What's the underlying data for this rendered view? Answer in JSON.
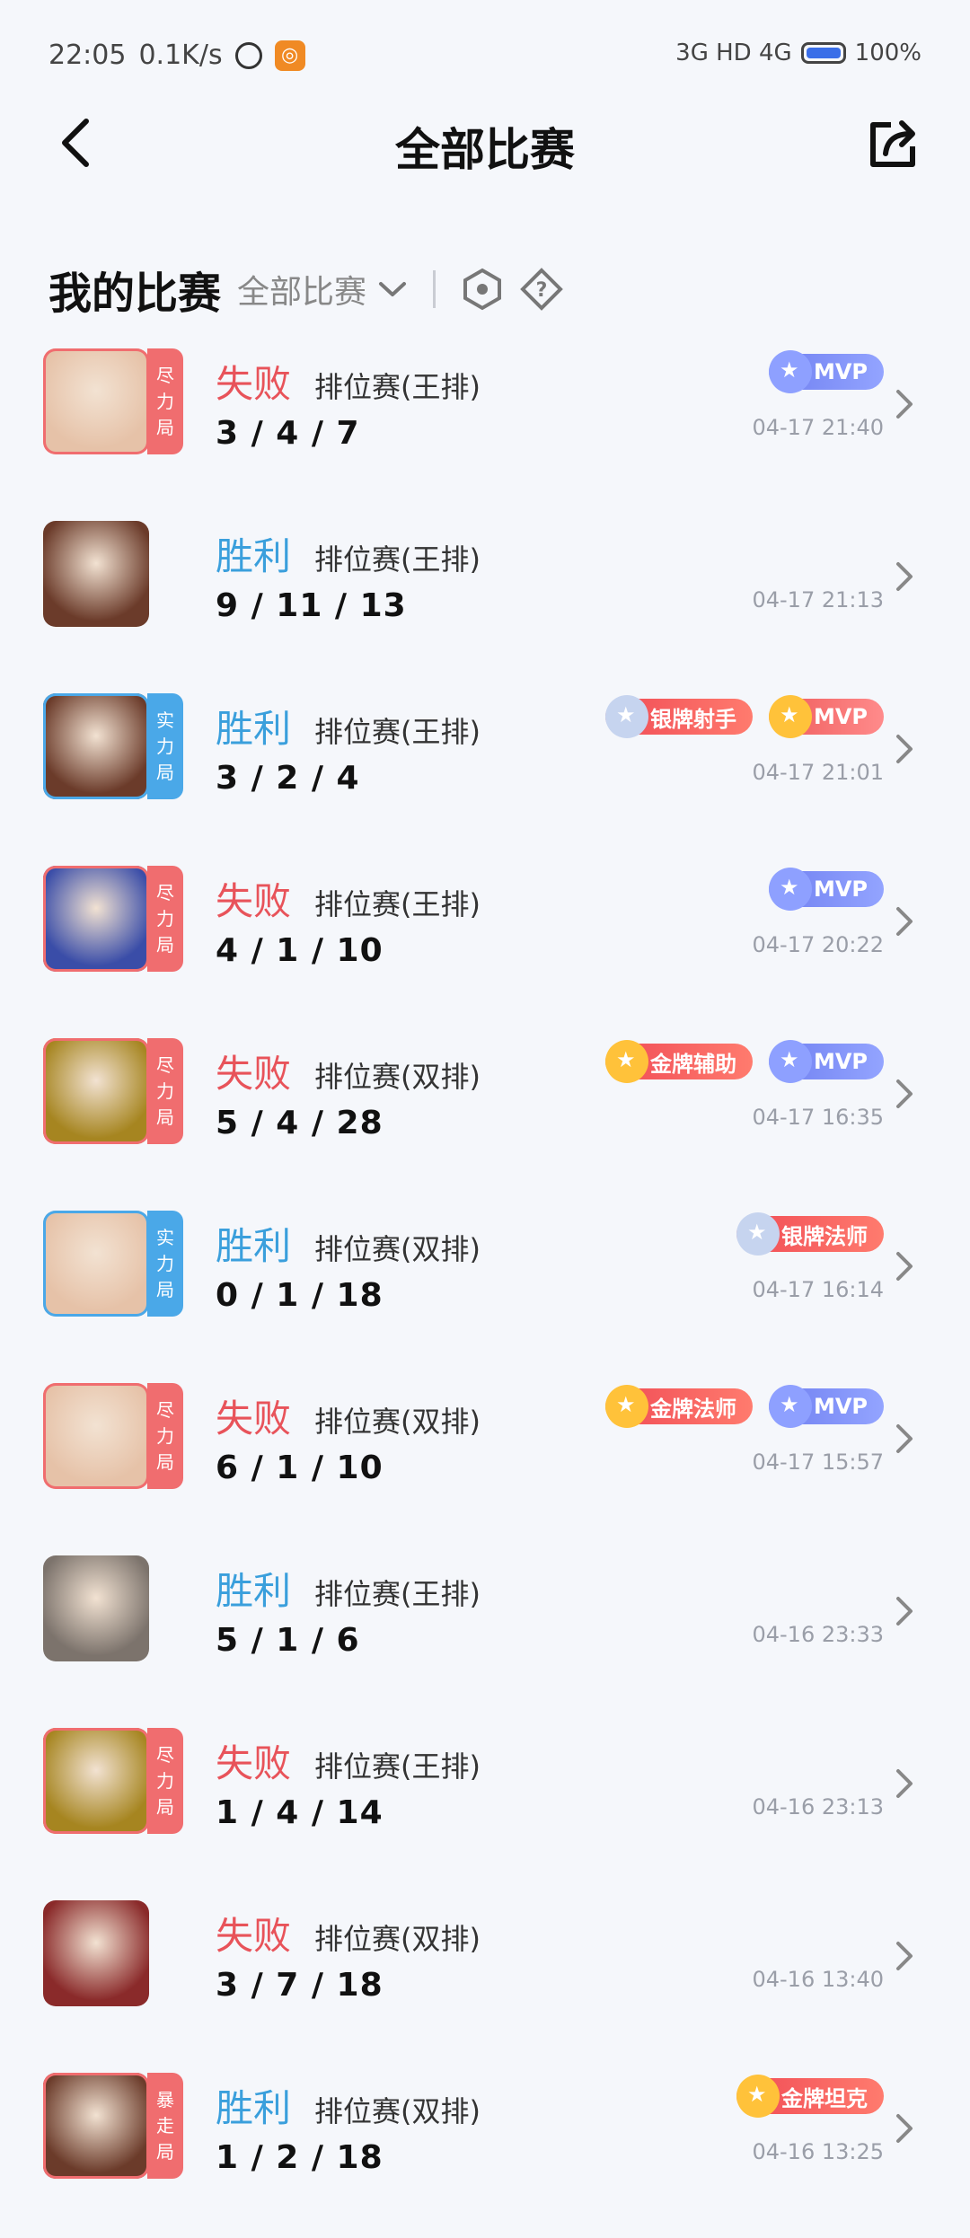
{
  "status_bar": {
    "time": "22:05",
    "speed": "0.1K/s",
    "network": "3G HD 4G",
    "battery": "100%"
  },
  "header": {
    "title": "全部比赛"
  },
  "filter": {
    "title": "我的比赛",
    "selected": "全部比赛"
  },
  "matches": [
    {
      "result": "失败",
      "mode": "排位赛(王排)",
      "kda": "3 / 4 / 7",
      "time": "04-17 21:40",
      "tag": "尽力局",
      "badges": [
        "MVP"
      ],
      "avatar_color": "#e6c2a8"
    },
    {
      "result": "胜利",
      "mode": "排位赛(王排)",
      "kda": "9 / 11 / 13",
      "time": "04-17 21:13",
      "tag": "",
      "badges": [],
      "avatar_color": "#6b3b2a"
    },
    {
      "result": "胜利",
      "mode": "排位赛(王排)",
      "kda": "3 / 2 / 4",
      "time": "04-17 21:01",
      "tag": "实力局",
      "badges": [
        "银牌射手",
        "MVP"
      ],
      "avatar_color": "#6b3b2a"
    },
    {
      "result": "失败",
      "mode": "排位赛(王排)",
      "kda": "4 / 1 / 10",
      "time": "04-17 20:22",
      "tag": "尽力局",
      "badges": [
        "MVP"
      ],
      "avatar_color": "#3a4da8"
    },
    {
      "result": "失败",
      "mode": "排位赛(双排)",
      "kda": "5 / 4 / 28",
      "time": "04-17 16:35",
      "tag": "尽力局",
      "badges": [
        "金牌辅助",
        "MVP"
      ],
      "avatar_color": "#a68520"
    },
    {
      "result": "胜利",
      "mode": "排位赛(双排)",
      "kda": "0 / 1 / 18",
      "time": "04-17 16:14",
      "tag": "实力局",
      "badges": [
        "银牌法师"
      ],
      "avatar_color": "#e6c2a8"
    },
    {
      "result": "失败",
      "mode": "排位赛(双排)",
      "kda": "6 / 1 / 10",
      "time": "04-17 15:57",
      "tag": "尽力局",
      "badges": [
        "金牌法师",
        "MVP"
      ],
      "avatar_color": "#e6c2a8"
    },
    {
      "result": "胜利",
      "mode": "排位赛(王排)",
      "kda": "5 / 1 / 6",
      "time": "04-16 23:33",
      "tag": "",
      "badges": [],
      "avatar_color": "#7c736c"
    },
    {
      "result": "失败",
      "mode": "排位赛(王排)",
      "kda": "1 / 4 / 14",
      "time": "04-16 23:13",
      "tag": "尽力局",
      "badges": [],
      "avatar_color": "#a68520"
    },
    {
      "result": "失败",
      "mode": "排位赛(双排)",
      "kda": "3 / 7 / 18",
      "time": "04-16 13:40",
      "tag": "",
      "badges": [],
      "avatar_color": "#8a2a2a"
    },
    {
      "result": "胜利",
      "mode": "排位赛(双排)",
      "kda": "1 / 2 / 18",
      "time": "04-16 13:25",
      "tag": "暴走局",
      "badges": [
        "金牌坦克"
      ],
      "avatar_color": "#6b3b2a"
    }
  ],
  "colors": {
    "lose": "#e8535a",
    "win": "#3a9fdc",
    "background": "#f5f7fb"
  },
  "icons": {
    "back": "chevron-left-icon",
    "share": "share-icon",
    "filter": "chevron-down-icon",
    "hex": "hexagon-icon",
    "help": "help-diamond-icon",
    "row_arrow": "chevron-right-icon"
  }
}
